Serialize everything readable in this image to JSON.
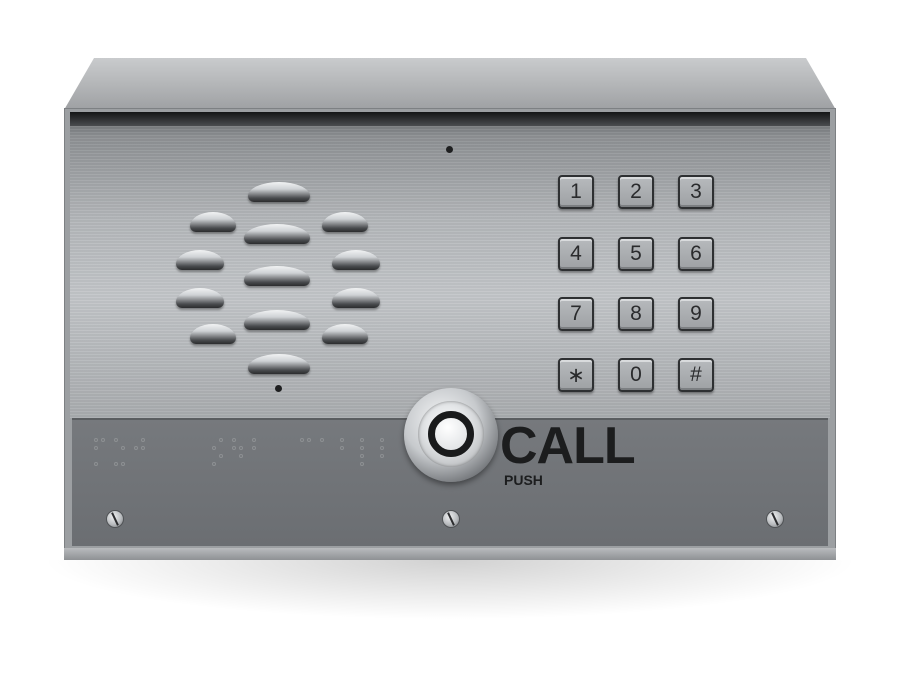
{
  "device": {
    "keypad": {
      "keys": [
        "1",
        "2",
        "3",
        "4",
        "5",
        "6",
        "7",
        "8",
        "9",
        "∗",
        "0",
        "#"
      ]
    },
    "call_button": {
      "label": "CALL",
      "sublabel": "PUSH"
    },
    "icons": {
      "speaker": "speaker-grille-icon",
      "microphone": "microphone-hole-icon",
      "screw": "screw-icon",
      "braille": "braille-text"
    },
    "colors": {
      "faceplate": "#b4b7ba",
      "lower_panel": "#6b6e72",
      "label_text": "#1c1d1e"
    }
  }
}
